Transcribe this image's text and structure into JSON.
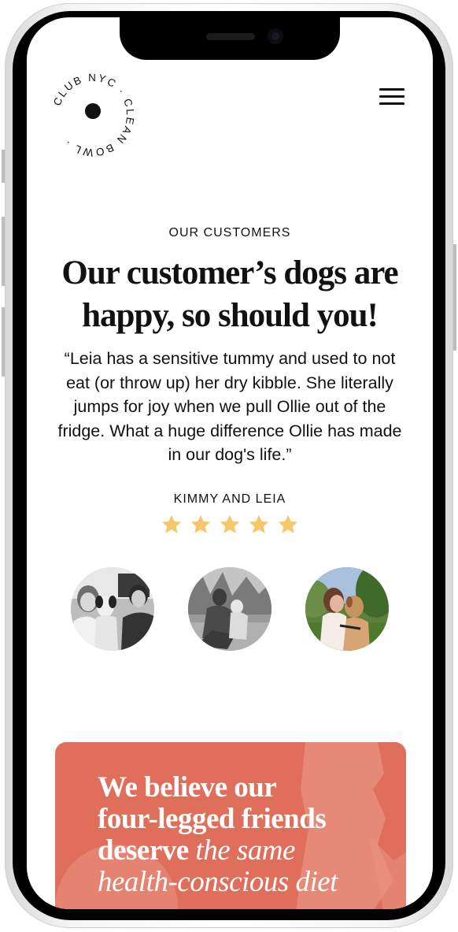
{
  "logo": {
    "ring_text": "CLUB NYC · CLEAN BOWL ·",
    "brand_name": "CLEAN BOWL CLUB NYC"
  },
  "header": {
    "menu_icon": "hamburger-menu-icon"
  },
  "testimonials": {
    "eyebrow": "OUR CUSTOMERS",
    "headline": "Our customer’s dogs are happy, so should you!",
    "quote": "“Leia has a sensitive tummy and used to not eat (or throw up) her dry kibble. She literally jumps for joy when we pull Ollie out of the fridge. What a huge difference Ollie has made in our dog's life.”",
    "author": "KIMMY AND LEIA",
    "rating": 5,
    "rating_max": 5,
    "star_color": "#f5c76a",
    "customer_photos": [
      "couple-with-dog-photo",
      "person-with-dog-outdoors-photo",
      "woman-kissing-dog-photo"
    ]
  },
  "banner": {
    "line_1": "We believe our",
    "line_2": "four-legged friends",
    "line_3_bold": "deserve ",
    "line_3_italic": "the same",
    "line_4_italic": "health-conscious diet",
    "background_color": "#df6f5b"
  }
}
